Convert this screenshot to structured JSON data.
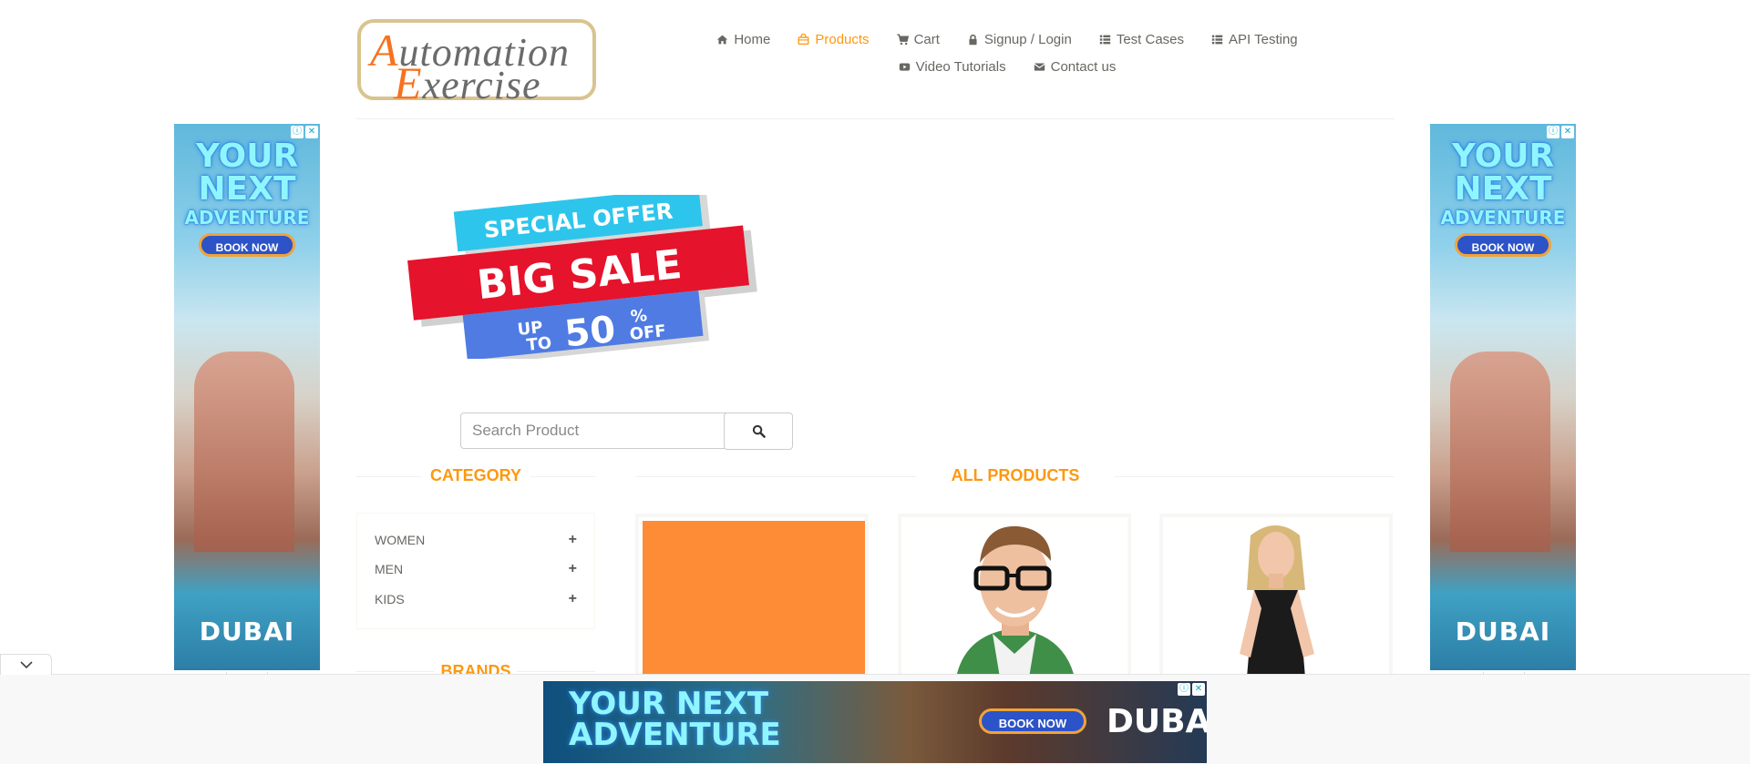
{
  "logo": {
    "line1_cap": "A",
    "line1_rest": "utomation",
    "line2_cap": "E",
    "line2_rest": "xercise"
  },
  "nav": {
    "row1": [
      {
        "label": "Home",
        "icon": "home-icon"
      },
      {
        "label": "Products",
        "icon": "shopping-bag-icon",
        "active": true
      },
      {
        "label": "Cart",
        "icon": "cart-icon"
      },
      {
        "label": "Signup / Login",
        "icon": "lock-icon"
      },
      {
        "label": "Test Cases",
        "icon": "list-icon"
      },
      {
        "label": "API Testing",
        "icon": "list-icon"
      }
    ],
    "row2": [
      {
        "label": "Video Tutorials",
        "icon": "youtube-icon"
      },
      {
        "label": "Contact us",
        "icon": "envelope-icon"
      }
    ]
  },
  "side_ad": {
    "headline_line1": "YOUR",
    "headline_line2": "NEXT",
    "headline_line3": "ADVENTURE",
    "button": "BOOK NOW",
    "brand": "DUBAI"
  },
  "bottom_ad": {
    "headline_line1": "YOUR NEXT",
    "headline_line2": "ADVENTURE",
    "button": "BOOK NOW",
    "brand": "DUBAI"
  },
  "banner": {
    "top": "SPECIAL OFFER",
    "middle": "BIG SALE",
    "up": "UP",
    "to": "TO",
    "percent": "50",
    "percent_sign": "%",
    "off": "OFF"
  },
  "search": {
    "placeholder": "Search Product",
    "value": ""
  },
  "category": {
    "title": "CATEGORY",
    "items": [
      {
        "label": "WOMEN"
      },
      {
        "label": "MEN"
      },
      {
        "label": "KIDS"
      }
    ]
  },
  "brands": {
    "title": "BRANDS"
  },
  "products": {
    "title": "ALL PRODUCTS"
  },
  "colors": {
    "accent": "#fe980f",
    "text": "#696763",
    "orange_tile": "#fe8b35"
  }
}
